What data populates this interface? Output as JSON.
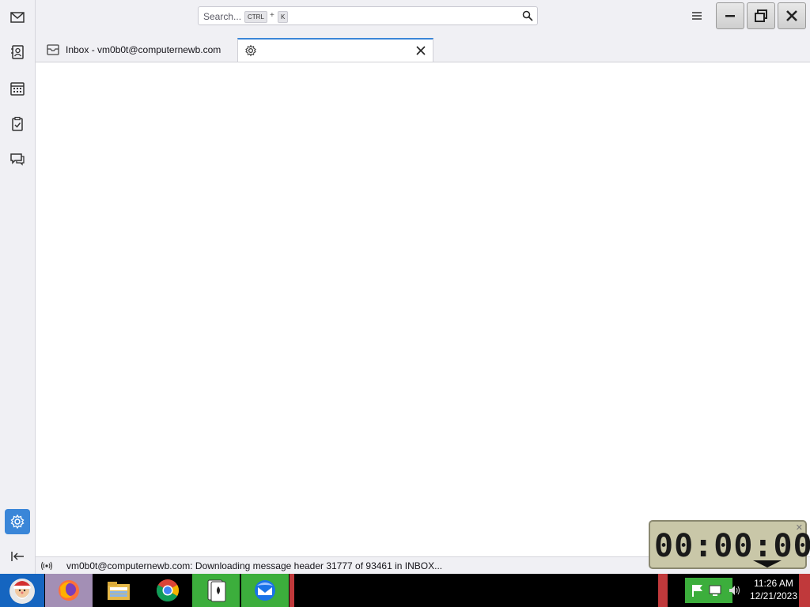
{
  "toolbar": {
    "search_placeholder": "Search...",
    "shortcut_modifier": "CTRL",
    "shortcut_plus": "+",
    "shortcut_key": "K"
  },
  "tabs": [
    {
      "label": "Inbox - vm0b0t@computernewb.com",
      "icon": "mail-icon",
      "active": false
    },
    {
      "label": "",
      "icon": "gear-icon",
      "active": true
    }
  ],
  "spaces": [
    "mail-icon",
    "address-book-icon",
    "calendar-icon",
    "tasks-icon",
    "chat-icon",
    "settings-icon",
    "collapse-icon"
  ],
  "status": {
    "text": "vm0b0t@computernewb.com: Downloading message header 31777 of 93461 in INBOX..."
  },
  "timer": {
    "display": "00:00:00"
  },
  "taskbar": {
    "clock_time": "11:26 AM",
    "clock_date": "12/21/2023"
  },
  "colors": {
    "accent": "#3a86d8",
    "taskbar_green": "#3cae3c",
    "taskbar_red": "#c0393b"
  }
}
